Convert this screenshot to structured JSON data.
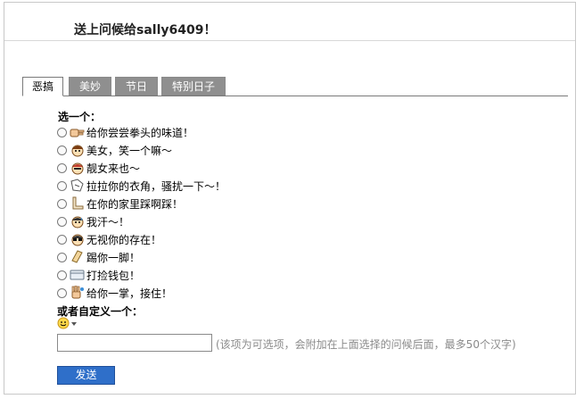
{
  "header": {
    "title": "送上问候给sally6409！"
  },
  "tabs": [
    {
      "label": "恶搞",
      "active": true
    },
    {
      "label": "美妙",
      "active": false
    },
    {
      "label": "节日",
      "active": false
    },
    {
      "label": "特别日子",
      "active": false
    }
  ],
  "choose_label": "选一个：",
  "options": [
    {
      "icon": "fist-icon",
      "label": "给你尝尝拳头的味道！"
    },
    {
      "icon": "girl-face-icon",
      "label": "美女，笑一个嘛～"
    },
    {
      "icon": "cool-face-icon",
      "label": "靓女来也～"
    },
    {
      "icon": "tug-icon",
      "label": "拉拉你的衣角，骚扰一下～！"
    },
    {
      "icon": "foot-icon",
      "label": "在你的家里踩啊踩！"
    },
    {
      "icon": "sweat-face-icon",
      "label": "我汗～！"
    },
    {
      "icon": "sunglasses-face-icon",
      "label": "无视你的存在！"
    },
    {
      "icon": "kick-icon",
      "label": "踢你一脚！"
    },
    {
      "icon": "wallet-icon",
      "label": "打捡钱包！"
    },
    {
      "icon": "palm-icon",
      "label": "给你一掌，接住！"
    }
  ],
  "custom_label": "或者自定义一个：",
  "emoji_picker": {
    "icon": "smiley-icon"
  },
  "custom_input": {
    "value": "",
    "placeholder": ""
  },
  "hint": "(该项为可选项，会附加在上面选择的问候后面，最多50个汉字)",
  "send_label": "发送"
}
